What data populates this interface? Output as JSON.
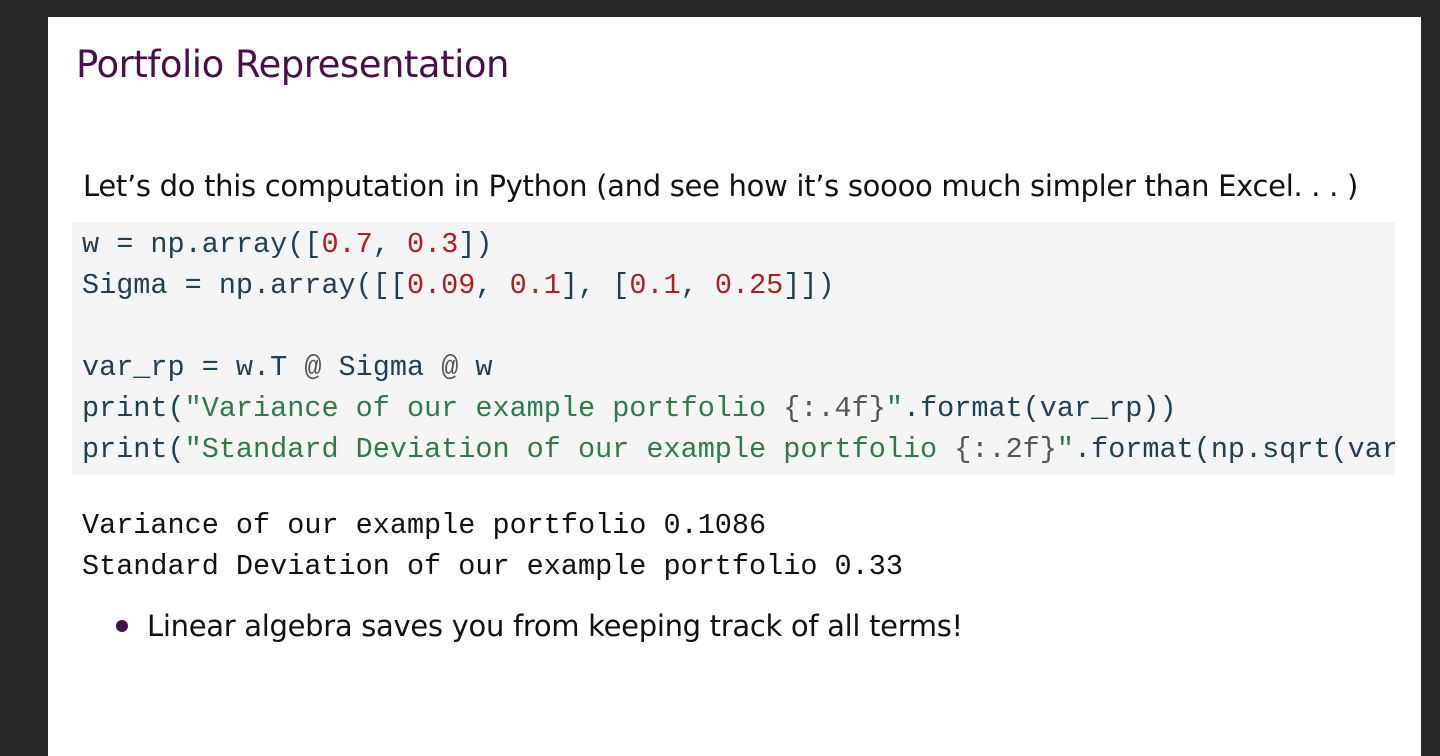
{
  "slide": {
    "title": "Portfolio Representation",
    "intro": "Let’s do this computation in Python (and see how it’s soooo much simpler than Excel. . . )",
    "code": {
      "lines": [
        [
          {
            "t": "w = np.array([",
            "c": "plain"
          },
          {
            "t": "0.7",
            "c": "num"
          },
          {
            "t": ", ",
            "c": "plain"
          },
          {
            "t": "0.3",
            "c": "num"
          },
          {
            "t": "])",
            "c": "plain"
          }
        ],
        [
          {
            "t": "Sigma = np.array([[",
            "c": "plain"
          },
          {
            "t": "0.09",
            "c": "num"
          },
          {
            "t": ", ",
            "c": "plain"
          },
          {
            "t": "0.1",
            "c": "num"
          },
          {
            "t": "], [",
            "c": "plain"
          },
          {
            "t": "0.1",
            "c": "num"
          },
          {
            "t": ", ",
            "c": "plain"
          },
          {
            "t": "0.25",
            "c": "num"
          },
          {
            "t": "]])",
            "c": "plain"
          }
        ],
        [],
        [
          {
            "t": "var_rp = w.T ",
            "c": "plain"
          },
          {
            "t": "@",
            "c": "op"
          },
          {
            "t": " Sigma ",
            "c": "plain"
          },
          {
            "t": "@",
            "c": "op"
          },
          {
            "t": " w",
            "c": "plain"
          }
        ],
        [
          {
            "t": "print(",
            "c": "plain"
          },
          {
            "t": "\"Variance of our example portfolio ",
            "c": "str"
          },
          {
            "t": "{:.4f}",
            "c": "op"
          },
          {
            "t": "\"",
            "c": "str"
          },
          {
            "t": ".format(var_rp))",
            "c": "plain"
          }
        ],
        [
          {
            "t": "print(",
            "c": "plain"
          },
          {
            "t": "\"Standard Deviation of our example portfolio ",
            "c": "str"
          },
          {
            "t": "{:.2f}",
            "c": "op"
          },
          {
            "t": "\"",
            "c": "str"
          },
          {
            "t": ".format(np.sqrt(var_rp)))",
            "c": "plain"
          }
        ]
      ]
    },
    "output": [
      "Variance of our example portfolio 0.1086",
      "Standard Deviation of our example portfolio 0.33"
    ],
    "bullets": [
      "Linear algebra saves you from keeping track of all terms!"
    ]
  }
}
